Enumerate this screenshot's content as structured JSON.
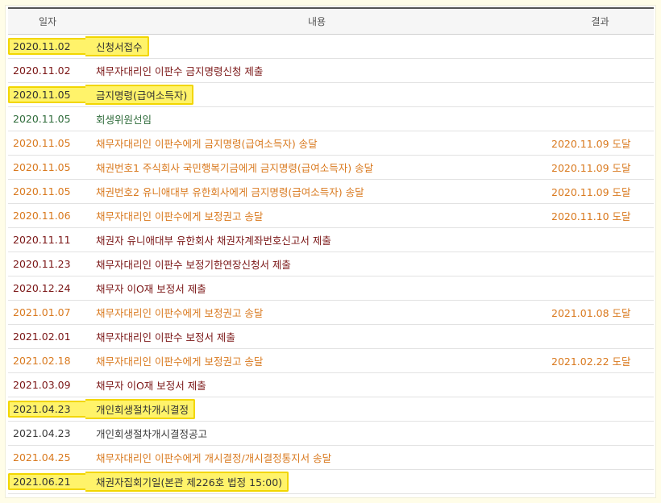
{
  "header": {
    "date": "일자",
    "content": "내용",
    "result": "결과"
  },
  "colors": {
    "highlight": "#fff36a",
    "highlight_border": "#f2d600",
    "dark": "#3a3a3a",
    "maroon": "#7a1515",
    "orange": "#d9791e",
    "green": "#2e6b3a"
  },
  "rows": [
    {
      "date": "2020.11.02",
      "content": "신청서접수",
      "result": "",
      "color": "dark",
      "highlight": true
    },
    {
      "date": "2020.11.02",
      "content": "채무자대리인 이판수 금지명령신청 제출",
      "result": "",
      "color": "maroon",
      "highlight": false
    },
    {
      "date": "2020.11.05",
      "content": "금지명령(급여소득자)",
      "result": "",
      "color": "dark",
      "highlight": true
    },
    {
      "date": "2020.11.05",
      "content": "회생위원선임",
      "result": "",
      "color": "green",
      "highlight": false
    },
    {
      "date": "2020.11.05",
      "content": "채무자대리인 이판수에게 금지명령(급여소득자) 송달",
      "result": "2020.11.09 도달",
      "color": "orange",
      "highlight": false
    },
    {
      "date": "2020.11.05",
      "content": "채권번호1 주식회사 국민행복기금에게 금지명령(급여소득자) 송달",
      "result": "2020.11.09 도달",
      "color": "orange",
      "highlight": false
    },
    {
      "date": "2020.11.05",
      "content": "채권번호2 유니애대부 유한회사에게 금지명령(급여소득자) 송달",
      "result": "2020.11.09 도달",
      "color": "orange",
      "highlight": false
    },
    {
      "date": "2020.11.06",
      "content": "채무자대리인 이판수에게 보정권고 송달",
      "result": "2020.11.10 도달",
      "color": "orange",
      "highlight": false
    },
    {
      "date": "2020.11.11",
      "content": "채권자 유니애대부 유한회사 채권자계좌번호신고서 제출",
      "result": "",
      "color": "maroon",
      "highlight": false
    },
    {
      "date": "2020.11.23",
      "content": "채무자대리인 이판수 보정기한연장신청서 제출",
      "result": "",
      "color": "maroon",
      "highlight": false
    },
    {
      "date": "2020.12.24",
      "content": "채무자 이O재 보정서 제출",
      "result": "",
      "color": "maroon",
      "highlight": false
    },
    {
      "date": "2021.01.07",
      "content": "채무자대리인 이판수에게 보정권고 송달",
      "result": "2021.01.08 도달",
      "color": "orange",
      "highlight": false
    },
    {
      "date": "2021.02.01",
      "content": "채무자대리인 이판수 보정서 제출",
      "result": "",
      "color": "maroon",
      "highlight": false
    },
    {
      "date": "2021.02.18",
      "content": "채무자대리인 이판수에게 보정권고 송달",
      "result": "2021.02.22 도달",
      "color": "orange",
      "highlight": false
    },
    {
      "date": "2021.03.09",
      "content": "채무자 이O재 보정서 제출",
      "result": "",
      "color": "maroon",
      "highlight": false
    },
    {
      "date": "2021.04.23",
      "content": "개인회생절차개시결정",
      "result": "",
      "color": "dark",
      "highlight": true
    },
    {
      "date": "2021.04.23",
      "content": "개인회생절차개시결정공고",
      "result": "",
      "color": "dark",
      "highlight": false
    },
    {
      "date": "2021.04.25",
      "content": "채무자대리인 이판수에게 개시결정/개시결정통지서 송달",
      "result": "",
      "color": "orange",
      "highlight": false
    },
    {
      "date": "2021.06.21",
      "content": "채권자집회기일(본관 제226호 법정 15:00)",
      "result": "",
      "color": "dark",
      "highlight": true
    }
  ]
}
